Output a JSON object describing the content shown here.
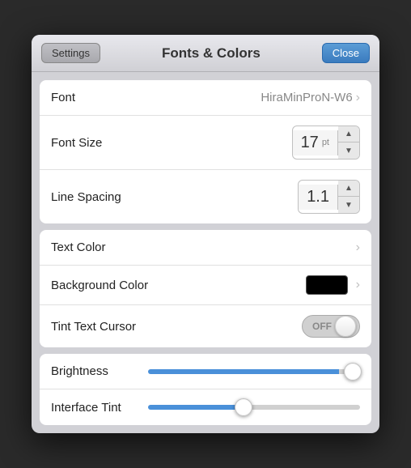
{
  "titleBar": {
    "settingsLabel": "Settings",
    "title": "Fonts & Colors",
    "closeLabel": "Close"
  },
  "fontSection": {
    "fontRow": {
      "label": "Font",
      "value": "HiraMinProN-W6"
    },
    "fontSizeRow": {
      "label": "Font Size",
      "value": "17",
      "unit": "pt"
    },
    "lineSpacingRow": {
      "label": "Line Spacing",
      "value": "1.1"
    }
  },
  "colorSection": {
    "textColorRow": {
      "label": "Text Color"
    },
    "backgroundColorRow": {
      "label": "Background Color"
    },
    "tintTextCursorRow": {
      "label": "Tint Text Cursor",
      "offLabel": "OFF"
    }
  },
  "brightnessSection": {
    "brightnessRow": {
      "label": "Brightness"
    },
    "interfaceTintRow": {
      "label": "Interface Tint"
    }
  }
}
